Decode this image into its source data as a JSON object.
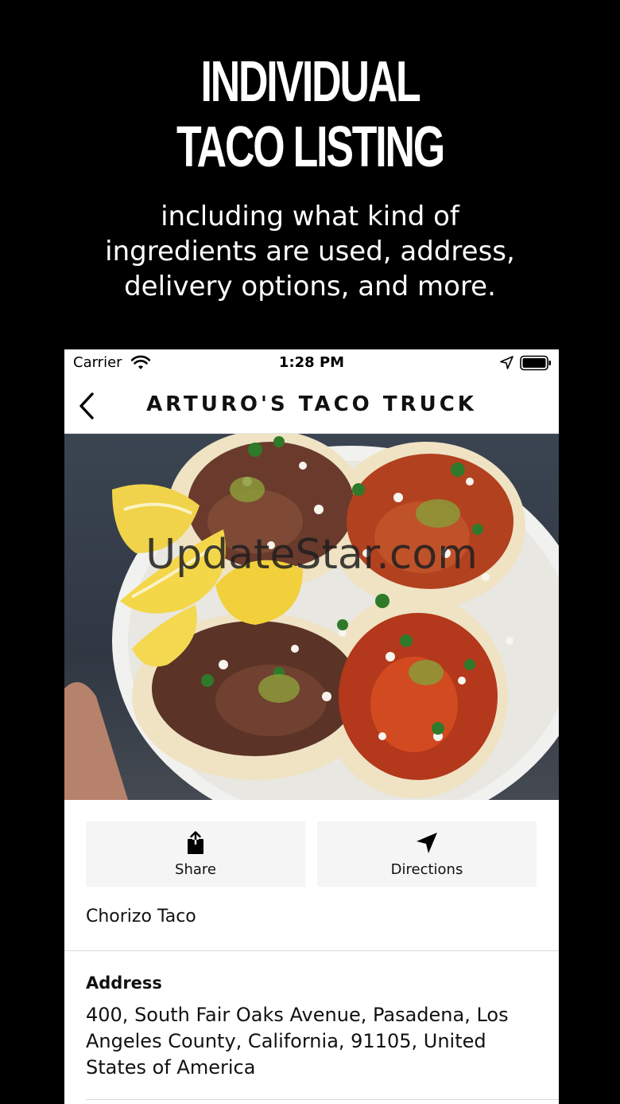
{
  "promo": {
    "title_line1": "INDIVIDUAL",
    "title_line2": "TACO LISTING",
    "subtitle": "including what kind of ingredients are used, address, delivery options, and more."
  },
  "status_bar": {
    "carrier": "Carrier",
    "time": "1:28 PM"
  },
  "nav": {
    "title": "ARTURO'S TACO TRUCK"
  },
  "hero": {
    "watermark": "UpdateStar.com"
  },
  "actions": {
    "share_label": "Share",
    "directions_label": "Directions"
  },
  "item": {
    "name": "Chorizo Taco"
  },
  "address": {
    "label": "Address",
    "value": "400, South Fair Oaks Avenue, Pasadena, Los Angeles County, California, 91105, United States of America"
  },
  "icons": [
    "wifi-icon",
    "location-arrow-icon",
    "battery-icon",
    "back-chevron-icon",
    "share-icon",
    "directions-arrow-icon"
  ]
}
